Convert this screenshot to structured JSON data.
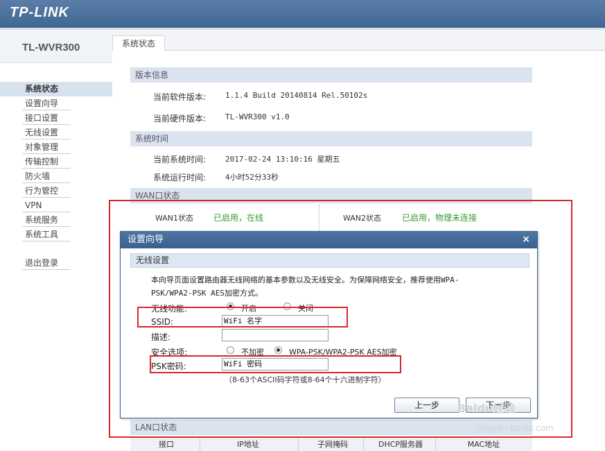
{
  "header": {
    "logo": "TP-LINK"
  },
  "sidebar": {
    "model": "TL-WVR300",
    "items": [
      {
        "label": "系统状态",
        "active": true
      },
      {
        "label": "设置向导"
      },
      {
        "label": "接口设置"
      },
      {
        "label": "无线设置"
      },
      {
        "label": "对象管理"
      },
      {
        "label": "传输控制"
      },
      {
        "label": "防火墙"
      },
      {
        "label": "行为管控"
      },
      {
        "label": "VPN"
      },
      {
        "label": "系统服务"
      },
      {
        "label": "系统工具"
      }
    ],
    "logout": "退出登录"
  },
  "tab": {
    "label": "系统状态"
  },
  "version": {
    "title": "版本信息",
    "software_label": "当前软件版本:",
    "software_value": "1.1.4 Build 20140814 Rel.50102s",
    "hardware_label": "当前硬件版本:",
    "hardware_value": "TL-WVR300 v1.0"
  },
  "time": {
    "title": "系统时间",
    "current_label": "当前系统时间:",
    "current_value": "2017-02-24 13:10:16 星期五",
    "uptime_label": "系统运行时间:",
    "uptime_value": "4小时52分33秒"
  },
  "wan": {
    "title": "WAN口状态",
    "wan1_label": "WAN1状态",
    "wan1_value": "已启用，在线",
    "wan2_label": "WAN2状态",
    "wan2_value": "已启用，物理未连接"
  },
  "lan": {
    "title": "LAN口状态",
    "columns": [
      "接口",
      "IP地址",
      "子网掩码",
      "DHCP服务器",
      "MAC地址"
    ]
  },
  "dialog": {
    "title": "设置向导",
    "close": "×",
    "section": "无线设置",
    "desc_line1": "本向导页面设置路由器无线网络的基本参数以及无线安全。为保障网络安全，推荐使用WPA-",
    "desc_line2": "PSK/WPA2-PSK AES加密方式。",
    "wireless_label": "无线功能:",
    "wireless_on": "开启",
    "wireless_off": "关闭",
    "ssid_label": "SSID:",
    "ssid_value": "WiFi 名字",
    "desc_label": "描述:",
    "desc_value": "",
    "security_label": "安全选项:",
    "security_none": "不加密",
    "security_wpa": "WPA-PSK/WPA2-PSK AES加密",
    "psk_label": "PSK密码:",
    "psk_value": "WiFi 密码",
    "hint": "（8-63个ASCII码字符或8-64个十六进制字符）",
    "prev_button": "上一步",
    "next_button": "下一步"
  },
  "watermark": {
    "brand": "Baidu经验",
    "url": "jingyan.baidu.com"
  },
  "colors": {
    "header": "#3f6592",
    "accent_green": "#3a9a2f",
    "highlight_red": "#d9262c"
  }
}
